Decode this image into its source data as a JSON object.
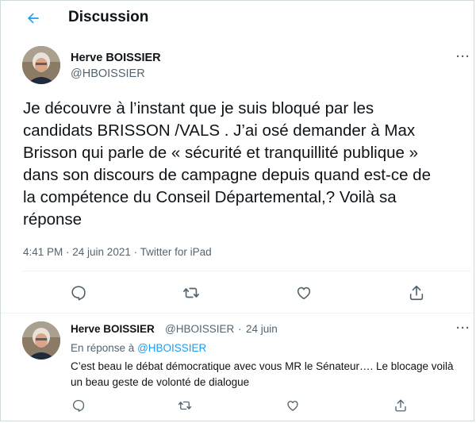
{
  "header": {
    "back_icon": "arrow-left-icon",
    "title": "Discussion"
  },
  "tweet": {
    "author_name": "Herve BOISSIER",
    "author_handle": "@HBOISSIER",
    "more_label": "···",
    "text": "Je découvre à l’instant que je suis bloqué par les candidats BRISSON /VALS . J’ai osé demander à Max Brisson qui parle de «  sécurité et tranquillité publique » dans son discours de campagne depuis quand est-ce de la compétence du Conseil Départemental,? Voilà sa réponse",
    "meta": "4:41 PM · 24 juin 2021 · Twitter for iPad",
    "actions": [
      "reply-icon",
      "retweet-icon",
      "like-icon",
      "share-icon"
    ]
  },
  "reply": {
    "author_name": "Herve BOISSIER",
    "author_handle": "@HBOISSIER",
    "separator": "·",
    "date": "24 juin",
    "more_label": "···",
    "replying_prefix": "En réponse à",
    "replying_handle": "@HBOISSIER",
    "text": "C’est beau le débat démocratique avec vous MR le Sénateur…. Le blocage voilà un beau geste de volonté de dialogue",
    "actions": [
      "reply-icon",
      "retweet-icon",
      "like-icon",
      "share-icon"
    ]
  },
  "colors": {
    "accent": "#1d9bf0",
    "text": "#0f1419",
    "secondary": "#536471",
    "border": "#cfd9de"
  }
}
